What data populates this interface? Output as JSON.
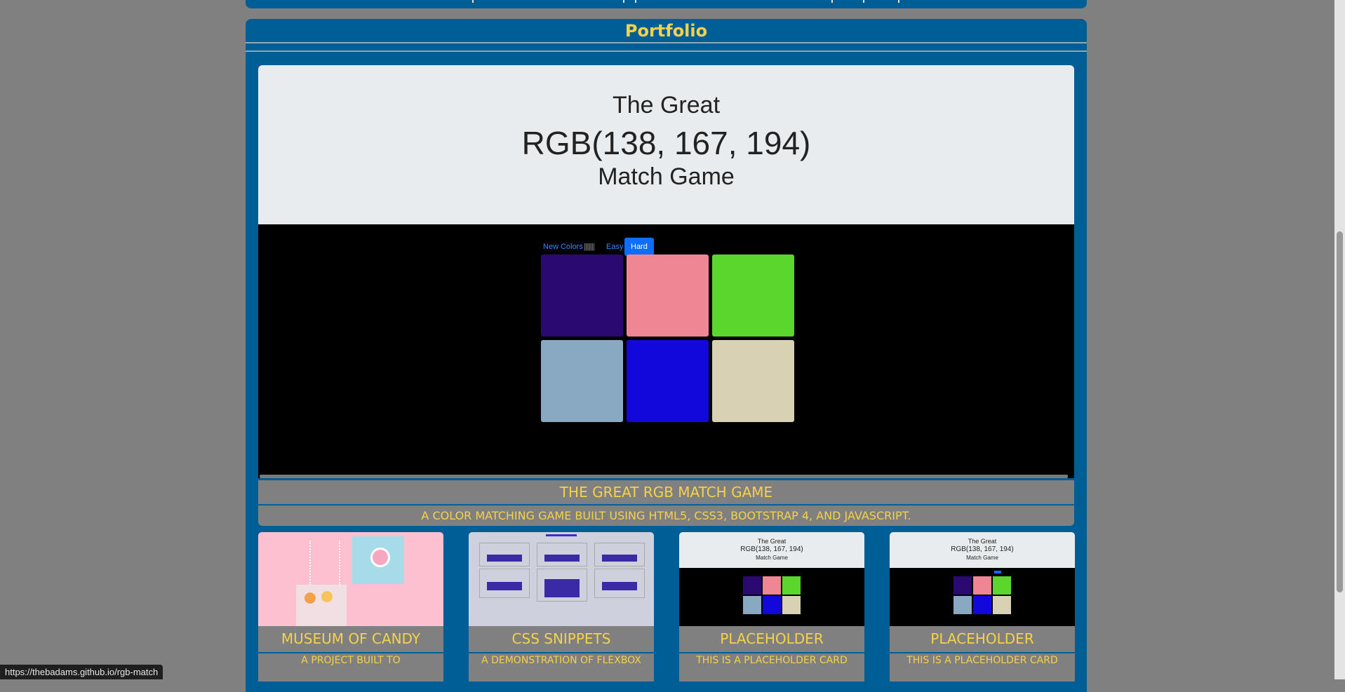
{
  "portfolio": {
    "title": "Portfolio"
  },
  "feature": {
    "hero_line1": "The Great",
    "hero_line2": "RGB(138, 167, 194)",
    "hero_line3": "Match Game",
    "controls": {
      "new_colors": "New Colors",
      "message": "||||||||",
      "easy": "Easy",
      "hard": "Hard"
    },
    "squares": [
      "#2a0a70",
      "#ef8694",
      "#5bd62c",
      "#89a8c2",
      "#1208db",
      "#d8d1b4"
    ],
    "title": "THE GREAT RGB MATCH GAME",
    "description": "A COLOR MATCHING GAME BUILT USING HTML5, CSS3, BOOTSTRAP 4, AND JAVASCRIPT."
  },
  "cards": [
    {
      "title": "MUSEUM OF CANDY",
      "description": "A PROJECT BUILT TO"
    },
    {
      "title": "CSS SNIPPETS",
      "description": "A DEMONSTRATION OF FLEXBOX"
    },
    {
      "title": "PLACEHOLDER",
      "description": "THIS IS A PLACEHOLDER CARD",
      "mini_l1": "The Great",
      "mini_l2": "RGB(138, 167, 194)",
      "mini_l3": "Match Game"
    },
    {
      "title": "PLACEHOLDER",
      "description": "THIS IS A PLACEHOLDER CARD",
      "mini_l1": "The Great",
      "mini_l2": "RGB(138, 167, 194)",
      "mini_l3": "Match Game"
    }
  ],
  "statusbar": {
    "url": "https://thebadams.github.io/rgb-match"
  }
}
